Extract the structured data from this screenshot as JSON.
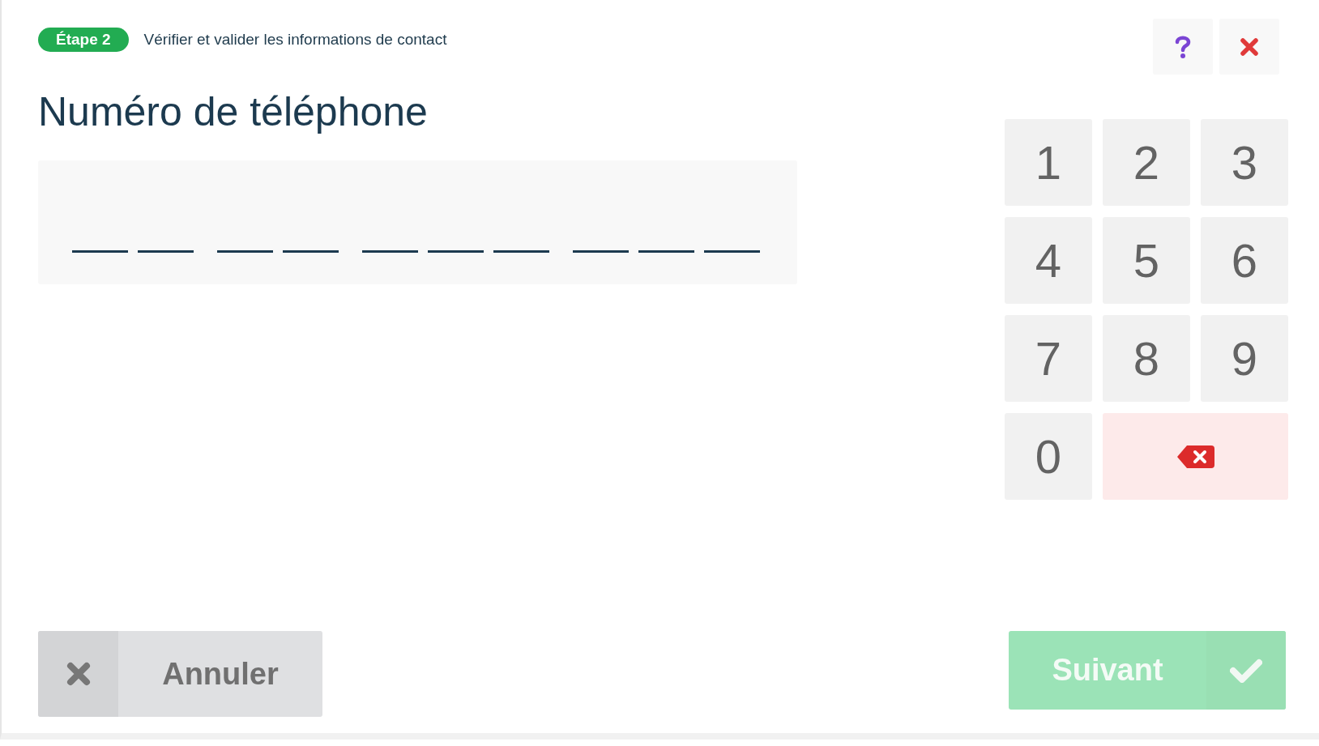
{
  "step": {
    "badge": "Étape 2",
    "description": "Vérifier et valider les informations de contact"
  },
  "title": "Numéro de téléphone",
  "phone_field": {
    "groups": [
      {
        "slots": [
          {
            "filled": false
          },
          {
            "filled": false
          }
        ]
      },
      {
        "slots": [
          {
            "filled": false
          },
          {
            "filled": false
          }
        ]
      },
      {
        "slots": [
          {
            "filled": false
          },
          {
            "filled": false
          },
          {
            "filled": false
          }
        ]
      },
      {
        "slots": [
          {
            "filled": false
          },
          {
            "filled": false
          },
          {
            "filled": false
          }
        ]
      }
    ]
  },
  "top_buttons": [
    {
      "kind": "help"
    },
    {
      "kind": "close"
    }
  ],
  "keypad": [
    {
      "kind": "digit",
      "label": "1"
    },
    {
      "kind": "digit",
      "label": "2"
    },
    {
      "kind": "digit",
      "label": "3"
    },
    {
      "kind": "digit",
      "label": "4"
    },
    {
      "kind": "digit",
      "label": "5"
    },
    {
      "kind": "digit",
      "label": "6"
    },
    {
      "kind": "digit",
      "label": "7"
    },
    {
      "kind": "digit",
      "label": "8"
    },
    {
      "kind": "digit",
      "label": "9"
    },
    {
      "kind": "digit",
      "label": "0"
    },
    {
      "kind": "backspace"
    }
  ],
  "cancel_button": {
    "label": "Annuler"
  },
  "next_button": {
    "label": "Suivant",
    "disabled": true
  }
}
